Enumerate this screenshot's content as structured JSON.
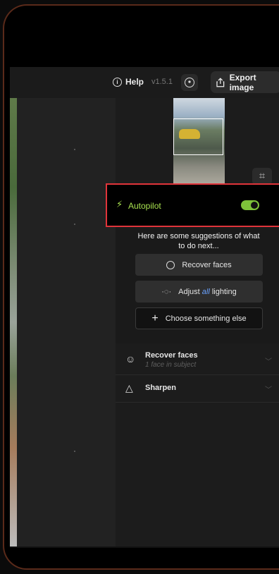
{
  "header": {
    "help_label": "Help",
    "version": "v1.5.1",
    "export_label": "Export image",
    "icons": {
      "help": "info-icon",
      "account": "user-circle-icon",
      "export": "share-icon"
    }
  },
  "thumbnail": {
    "crop_icon": "crop-icon"
  },
  "autopilot": {
    "label": "Autopilot",
    "enabled": true,
    "accent": "#a7e04f",
    "icon": "bolt-icon"
  },
  "suggestions": {
    "intro": "Here are some suggestions of what to do next...",
    "buttons": [
      {
        "label": "Recover faces",
        "icon": "face-icon"
      },
      {
        "prefix": "Adjust ",
        "emphasis": "all",
        "suffix": " lighting",
        "icon": "light-icon"
      },
      {
        "label": "Choose something else",
        "icon": "plus-icon"
      }
    ]
  },
  "sections": [
    {
      "title": "Recover faces",
      "subtitle": "1 face in subject",
      "icon": "face-icon"
    },
    {
      "title": "Sharpen",
      "icon": "triangle-icon"
    }
  ]
}
